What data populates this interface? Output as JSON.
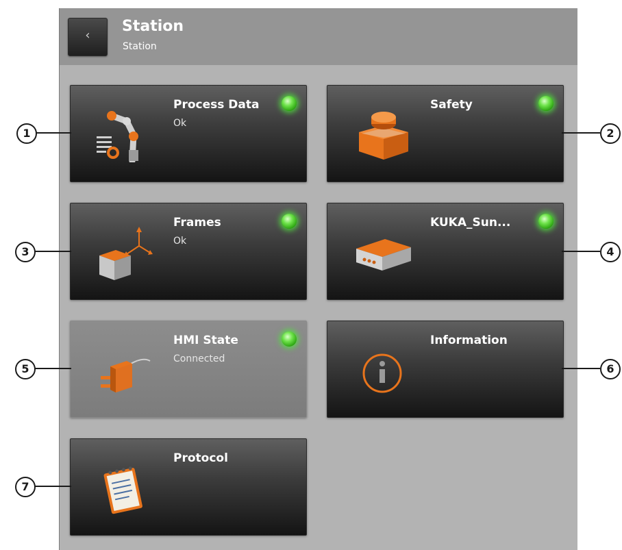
{
  "header": {
    "back_icon": "chevron-left-icon",
    "back_glyph": "‹",
    "title": "Station",
    "subtitle": "Station"
  },
  "tiles": [
    {
      "title": "Process Data",
      "status": "Ok",
      "led": "green",
      "icon": "robot-arm-process-icon",
      "enabled": true
    },
    {
      "title": "Safety",
      "status": "",
      "led": "green",
      "icon": "emergency-stop-icon",
      "enabled": true
    },
    {
      "title": "Frames",
      "status": "Ok",
      "led": "green",
      "icon": "frame-coordinates-icon",
      "enabled": true
    },
    {
      "title": "KUKA_Sun...",
      "status": "",
      "led": "green",
      "icon": "controller-box-icon",
      "enabled": true
    },
    {
      "title": "HMI State",
      "status": "Connected",
      "led": "green",
      "icon": "plug-icon",
      "enabled": false
    },
    {
      "title": "Information",
      "status": "",
      "led": "none",
      "icon": "info-icon",
      "enabled": true
    },
    {
      "title": "Protocol",
      "status": "",
      "led": "none",
      "icon": "notepad-icon",
      "enabled": true
    }
  ],
  "callouts": [
    "1",
    "2",
    "3",
    "4",
    "5",
    "6",
    "7"
  ],
  "colors": {
    "accent": "#e8741c",
    "led_green": "#5fe23c",
    "panel": "#b3b3b3",
    "header": "#959595"
  }
}
